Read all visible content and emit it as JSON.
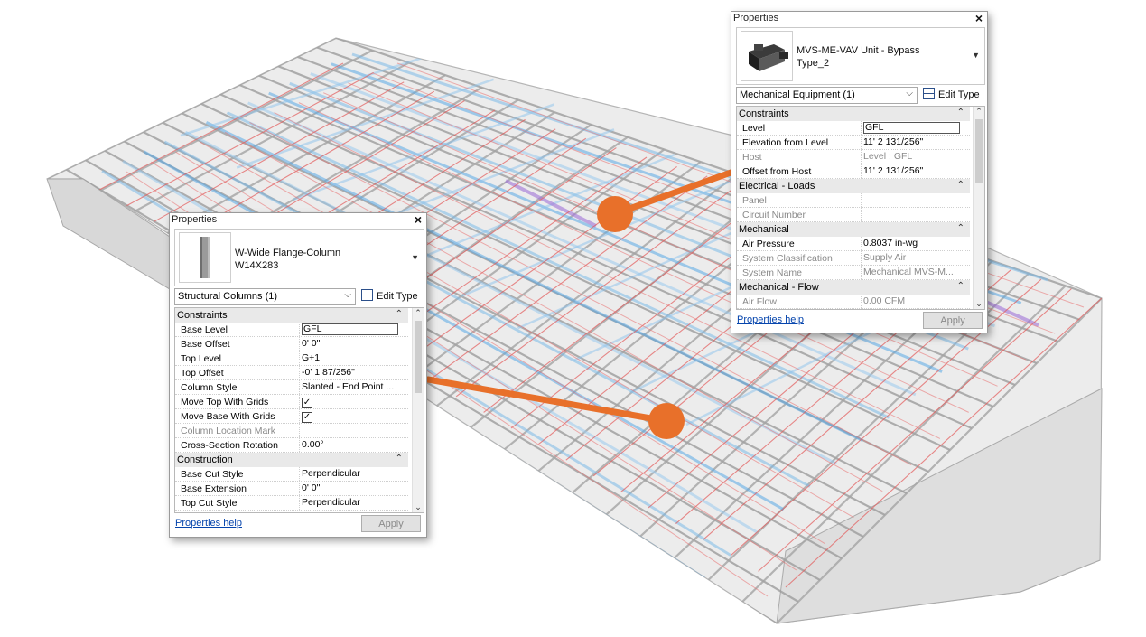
{
  "colors": {
    "callout": "#e8702a",
    "panel_bg": "#ffffff",
    "group_header": "#e9e9e9",
    "link": "#0645ad"
  },
  "panel_mech": {
    "title": "Properties",
    "close": "✕",
    "type_name_line1": "MVS-ME-VAV Unit - Bypass",
    "type_name_line2": "Type_2",
    "category": "Mechanical Equipment (1)",
    "edit_type": "Edit Type",
    "groups": [
      {
        "name": "Constraints",
        "rows": [
          {
            "key": "Level",
            "value": "GFL",
            "dim": false,
            "input": true
          },
          {
            "key": "Elevation from Level",
            "value": "11'  2 131/256\"",
            "dim": false
          },
          {
            "key": "Host",
            "value": "Level : GFL",
            "dim": true
          },
          {
            "key": "Offset from Host",
            "value": "11'  2 131/256\"",
            "dim": false
          }
        ]
      },
      {
        "name": "Electrical - Loads",
        "rows": [
          {
            "key": "Panel",
            "value": "",
            "dim": true
          },
          {
            "key": "Circuit Number",
            "value": "",
            "dim": true
          }
        ]
      },
      {
        "name": "Mechanical",
        "rows": [
          {
            "key": "Air Pressure",
            "value": "0.8037 in-wg",
            "dim": false
          },
          {
            "key": "System Classification",
            "value": "Supply Air",
            "dim": true
          },
          {
            "key": "System Name",
            "value": "Mechanical MVS-M...",
            "dim": true
          }
        ]
      },
      {
        "name": "Mechanical - Flow",
        "rows": [
          {
            "key": "Air Flow",
            "value": "0.00 CFM",
            "dim": true
          }
        ]
      }
    ],
    "help": "Properties help",
    "apply": "Apply"
  },
  "panel_struct": {
    "title": "Properties",
    "close": "✕",
    "type_name_line1": "W-Wide Flange-Column",
    "type_name_line2": "W14X283",
    "category": "Structural Columns (1)",
    "edit_type": "Edit Type",
    "groups": [
      {
        "name": "Constraints",
        "rows": [
          {
            "key": "Base Level",
            "value": "GFL",
            "dim": false,
            "input": true
          },
          {
            "key": "Base Offset",
            "value": "0'  0\"",
            "dim": false
          },
          {
            "key": "Top Level",
            "value": "G+1",
            "dim": false
          },
          {
            "key": "Top Offset",
            "value": "-0'  1 87/256\"",
            "dim": false
          },
          {
            "key": "Column Style",
            "value": "Slanted - End Point ...",
            "dim": false
          },
          {
            "key": "Move Top With Grids",
            "value": "",
            "dim": false,
            "check": true
          },
          {
            "key": "Move Base With Grids",
            "value": "",
            "dim": false,
            "check": true
          },
          {
            "key": "Column Location Mark",
            "value": "",
            "dim": true
          },
          {
            "key": "Cross-Section Rotation",
            "value": "0.00°",
            "dim": false
          }
        ]
      },
      {
        "name": "Construction",
        "rows": [
          {
            "key": "Base Cut Style",
            "value": "Perpendicular",
            "dim": false
          },
          {
            "key": "Base Extension",
            "value": "0'  0\"",
            "dim": false
          },
          {
            "key": "Top Cut Style",
            "value": "Perpendicular",
            "dim": false
          }
        ]
      }
    ],
    "help": "Properties help",
    "apply": "Apply"
  },
  "icons": {
    "collapse": "chevron-up-double-icon",
    "dropdown": "chevron-down-icon",
    "check": "checkmark-icon"
  }
}
